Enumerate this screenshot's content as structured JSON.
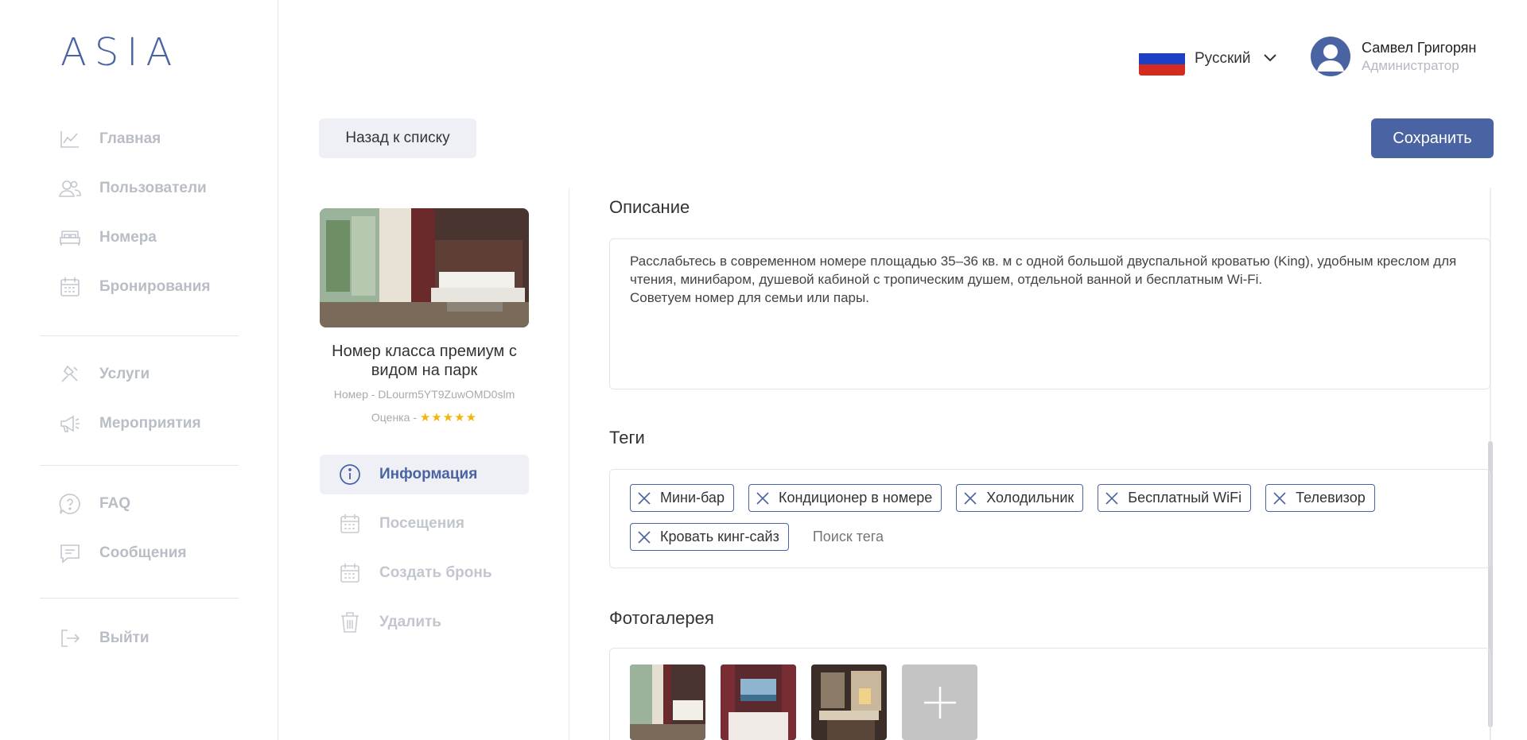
{
  "app": {
    "logo": "ASIA"
  },
  "sidebar": {
    "groups": [
      [
        {
          "label": "Главная",
          "icon": "chart-icon"
        },
        {
          "label": "Пользователи",
          "icon": "users-icon"
        },
        {
          "label": "Номера",
          "icon": "bed-icon"
        },
        {
          "label": "Бронирования",
          "icon": "calendar-icon"
        }
      ],
      [
        {
          "label": "Услуги",
          "icon": "service-icon"
        },
        {
          "label": "Мероприятия",
          "icon": "megaphone-icon"
        }
      ],
      [
        {
          "label": "FAQ",
          "icon": "question-icon"
        },
        {
          "label": "Сообщения",
          "icon": "message-icon"
        }
      ],
      [
        {
          "label": "Выйти",
          "icon": "logout-icon"
        }
      ]
    ]
  },
  "header": {
    "language": "Русский",
    "user": {
      "name": "Самвел Григорян",
      "role": "Администратор"
    }
  },
  "actions": {
    "back": "Назад к списку",
    "save": "Сохранить"
  },
  "room": {
    "title": "Номер класса премиум с видом на парк",
    "id_text": "Номер - DLourm5YT9ZuwOMD0slm",
    "rating_label": "Оценка -",
    "rating_stars": "★★★★★",
    "rating_value": 5
  },
  "room_menu": [
    {
      "label": "Информация",
      "icon": "info-icon",
      "active": true
    },
    {
      "label": "Посещения",
      "icon": "calendar-icon",
      "active": false
    },
    {
      "label": "Создать бронь",
      "icon": "calendar-icon",
      "active": false
    },
    {
      "label": "Удалить",
      "icon": "trash-icon",
      "active": false
    }
  ],
  "description": {
    "title": "Описание",
    "line1": "Расслабьтесь в современном номере площадью 35–36 кв. м с одной большой двуспальной кроватью (King), удобным креслом для чтения, минибаром, душевой кабиной с тропическим душем, отдельной ванной и бесплатным Wi-Fi.",
    "line2": "Советуем номер для семьи или пары."
  },
  "tags": {
    "title": "Теги",
    "items": [
      "Мини-бар",
      "Кондиционер в номере",
      "Холодильник",
      "Бесплатный WiFi",
      "Телевизор",
      "Кровать кинг-сайз"
    ],
    "search_placeholder": "Поиск тега"
  },
  "gallery": {
    "title": "Фотогалерея",
    "photo_count": 3
  },
  "colors": {
    "accent": "#4a64a3",
    "muted": "#b9bdc6",
    "star": "#f2b50f"
  }
}
